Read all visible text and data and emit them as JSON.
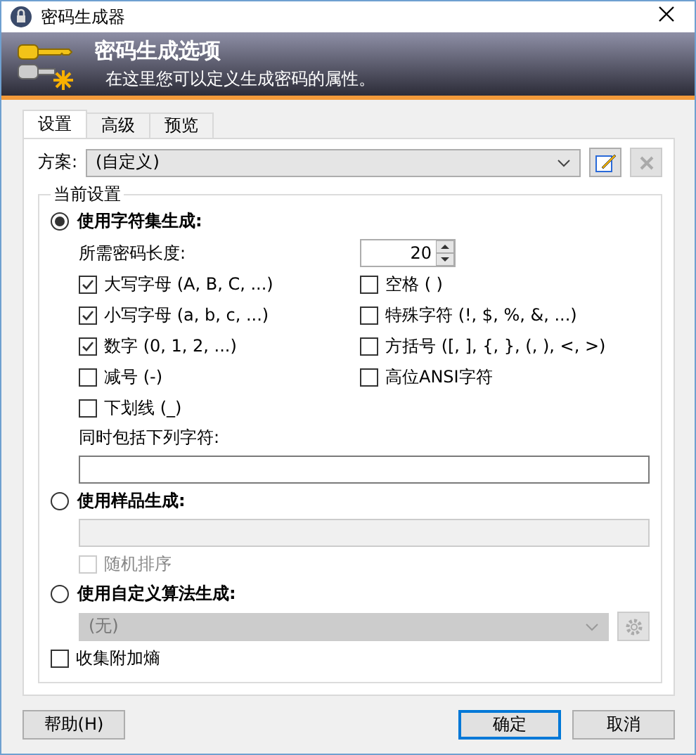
{
  "window": {
    "title": "密码生成器"
  },
  "banner": {
    "title": "密码生成选项",
    "subtitle": "在这里您可以定义生成密码的属性。"
  },
  "tabs": [
    {
      "label": "设置",
      "selected": true
    },
    {
      "label": "高级",
      "selected": false
    },
    {
      "label": "预览",
      "selected": false
    }
  ],
  "profile": {
    "label": "方案:",
    "value": "(自定义)"
  },
  "group": {
    "title": "当前设置"
  },
  "charset": {
    "label": "使用字符集生成:",
    "selected": true,
    "length_label": "所需密码长度:",
    "length": "20",
    "options": [
      {
        "label": "大写字母 (A, B, C, ...)",
        "checked": true
      },
      {
        "label": "空格 ( )",
        "checked": false
      },
      {
        "label": "小写字母 (a, b, c, ...)",
        "checked": true
      },
      {
        "label": "特殊字符 (!, $, %, &, ...)",
        "checked": false
      },
      {
        "label": "数字 (0, 1, 2, ...)",
        "checked": true
      },
      {
        "label": "方括号 ([, ], {, }, (, ), <, >)",
        "checked": false
      },
      {
        "label": "减号 (-)",
        "checked": false
      },
      {
        "label": "高位ANSI字符",
        "checked": false
      },
      {
        "label": "下划线 (_)",
        "checked": false
      }
    ],
    "include_label": "同时包括下列字符:"
  },
  "pattern": {
    "label": "使用样品生成:",
    "selected": false,
    "shuffle": {
      "label": "随机排序",
      "checked": false,
      "disabled": true
    }
  },
  "custom": {
    "label": "使用自定义算法生成:",
    "selected": false,
    "value": "(无)",
    "disabled": true
  },
  "entropy": {
    "label": "收集附加熵",
    "checked": false
  },
  "buttons": [
    {
      "label": "帮助(H)",
      "default": false
    },
    {
      "label": "确定",
      "default": true
    },
    {
      "label": "取消",
      "default": false
    }
  ]
}
